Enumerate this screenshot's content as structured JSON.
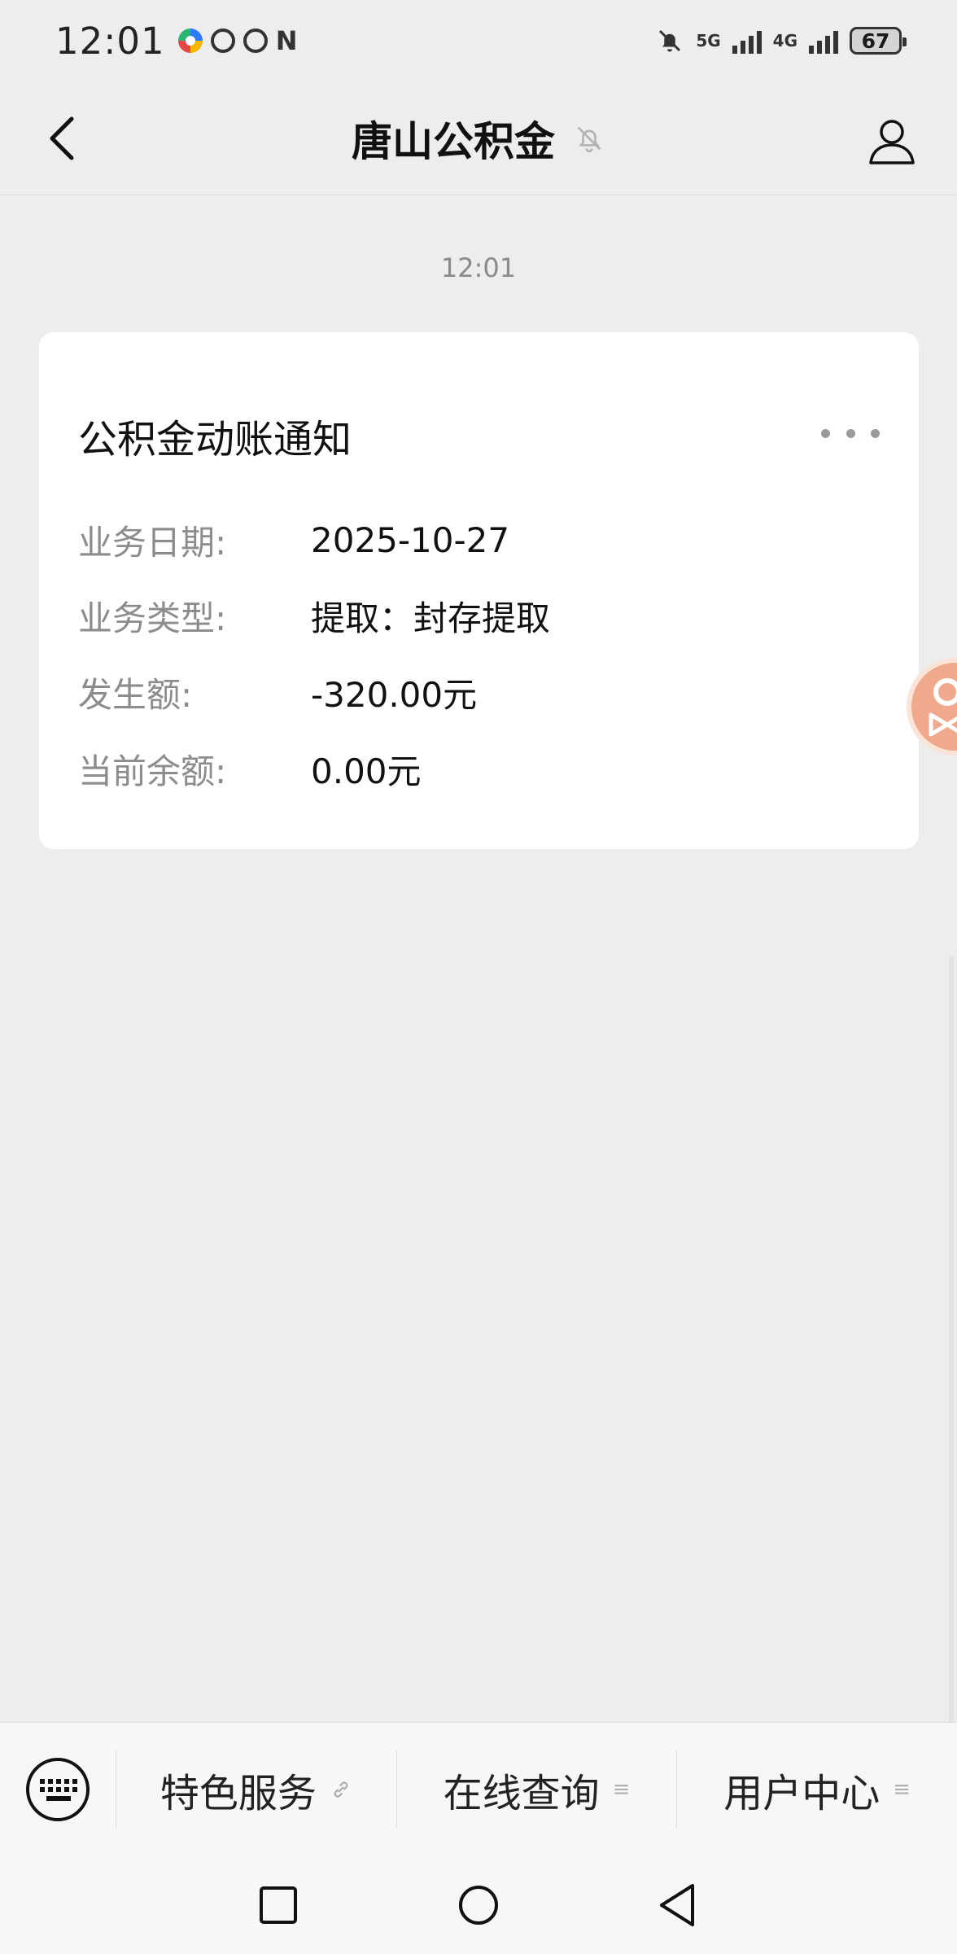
{
  "status_bar": {
    "time": "12:01",
    "signal_1": "5G",
    "signal_2": "4G",
    "battery": "67",
    "app_icons": [
      "multicolor-app-icon",
      "speed-app-icon",
      "gauge-app-icon"
    ],
    "nfc": "N"
  },
  "header": {
    "title": "唐山公积金",
    "back_icon": "chevron-left-icon",
    "mute_icon": "bell-off-icon",
    "profile_icon": "person-icon"
  },
  "chat": {
    "timestamp": "12:01",
    "card": {
      "title": "公积金动账通知",
      "fields": [
        {
          "label": "业务日期:",
          "value": "2025-10-27"
        },
        {
          "label": "业务类型:",
          "value": "提取：封存提取"
        },
        {
          "label": "发生额:",
          "value": "-320.00元"
        },
        {
          "label": "当前余额:",
          "value": "0.00元"
        }
      ]
    }
  },
  "bottom_menu": {
    "items": [
      {
        "label": "特色服务",
        "suffix": "🔗"
      },
      {
        "label": "在线查询",
        "suffix": "≡"
      },
      {
        "label": "用户中心",
        "suffix": "≡"
      }
    ]
  },
  "colors": {
    "background": "#ededed",
    "card": "#ffffff",
    "menu": "#f7f7f7",
    "float_widget": "#f0a98d"
  }
}
